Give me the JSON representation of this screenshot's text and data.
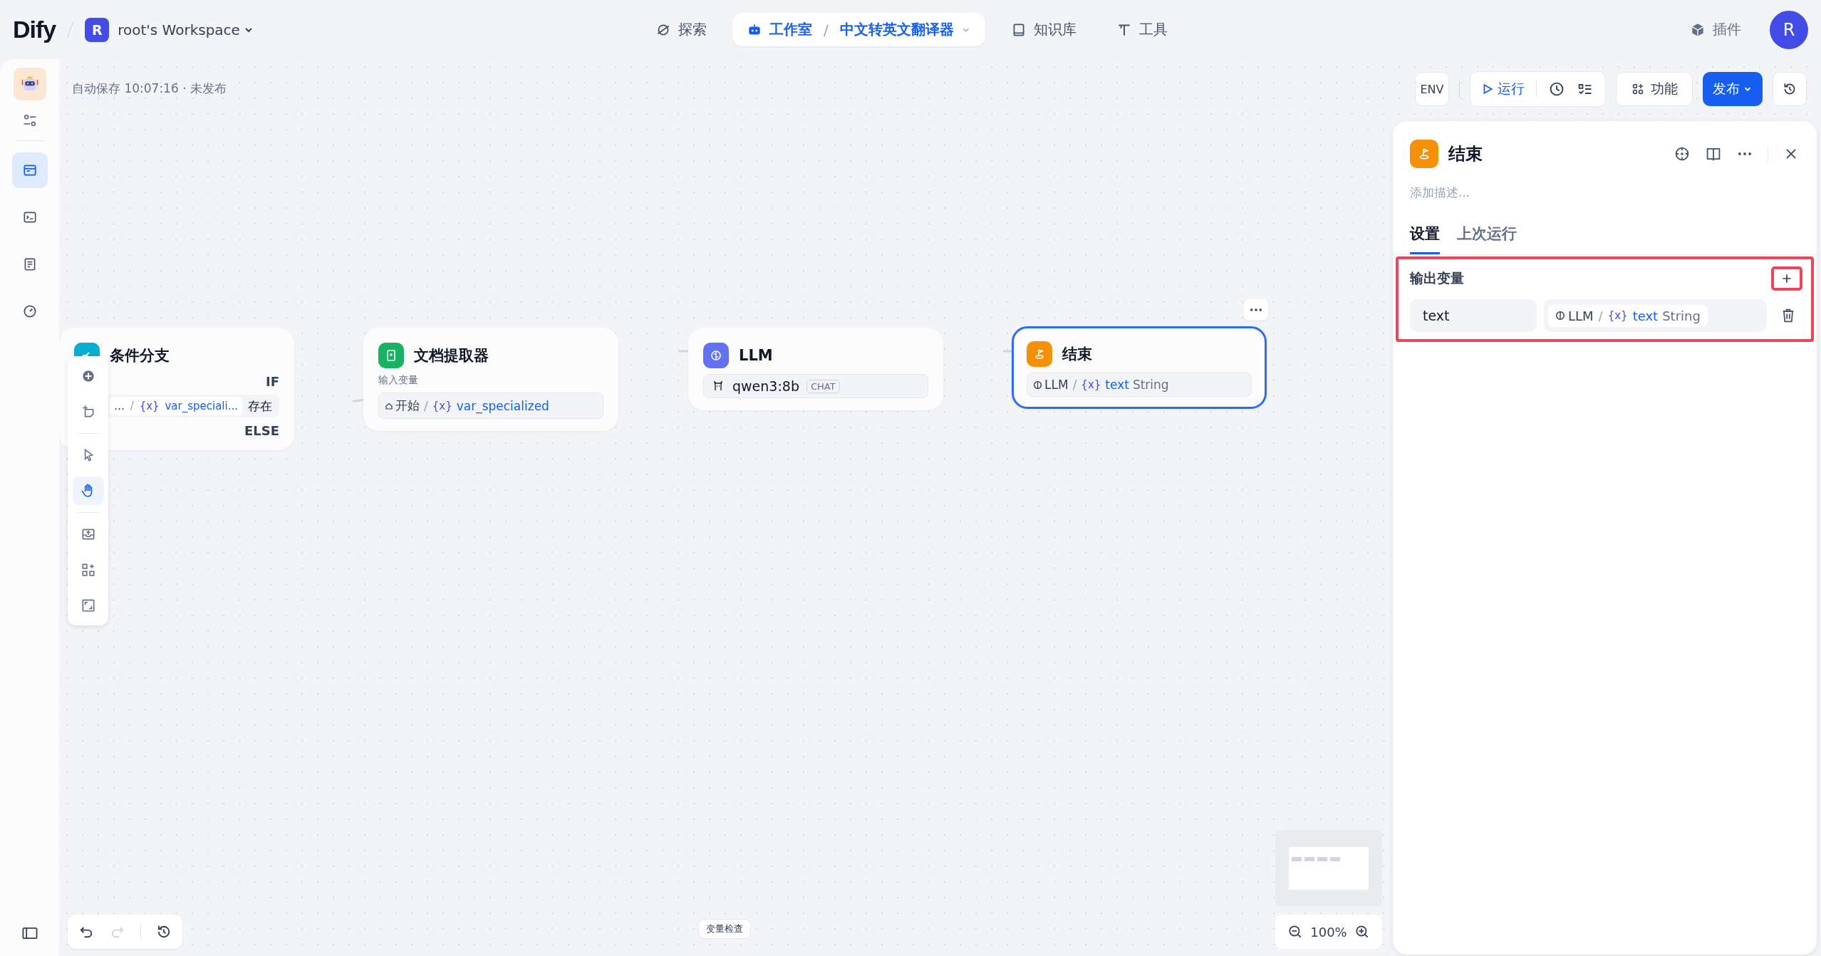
{
  "header": {
    "logo": "Dify",
    "workspace": {
      "initial": "R",
      "name": "root's Workspace"
    },
    "nav": [
      {
        "kind": "explore",
        "label": "探索",
        "selected": false
      },
      {
        "kind": "studio",
        "label": "工作室",
        "separator": "/",
        "app_name": "中文转英文翻译器",
        "selected": true
      },
      {
        "kind": "knowledge",
        "label": "知识库",
        "selected": false
      },
      {
        "kind": "tools",
        "label": "工具",
        "selected": false
      }
    ],
    "plugins": "插件",
    "avatar": "R"
  },
  "rail": [
    {
      "kind": "workflow",
      "selected": true
    },
    {
      "kind": "logs",
      "selected": false
    },
    {
      "kind": "annotations",
      "selected": false
    },
    {
      "kind": "monitor",
      "selected": false
    }
  ],
  "autosave": "自动保存 10:07:16 · 未发布",
  "toolbar": {
    "env": "ENV",
    "run": "运行",
    "features": "功能",
    "publish": "发布"
  },
  "nodes": [
    {
      "kind": "if-else",
      "title": "条件分支",
      "color": "#06aed4",
      "selected": false,
      "if_label": "IF",
      "else_label": "ELSE",
      "condition": {
        "ref": {
          "source": "…",
          "separator": "/",
          "marker": "{x}",
          "variable": "var_speciali..."
        },
        "operator": "存在"
      }
    },
    {
      "kind": "doc-extractor",
      "title": "文档提取器",
      "color": "#16b364",
      "selected": false,
      "input_label": "输入变量",
      "ref": {
        "source": "开始",
        "separator": "/",
        "marker": "{x}",
        "variable": "var_specialized"
      }
    },
    {
      "kind": "llm",
      "title": "LLM",
      "color": "#6172f3",
      "selected": false,
      "model": "qwen3:8b",
      "mode": "CHAT"
    },
    {
      "kind": "end",
      "title": "结束",
      "color": "#f79009",
      "selected": true,
      "ref": {
        "source": "LLM",
        "separator": "/",
        "marker": "{x}",
        "variable": "text",
        "type": "String"
      }
    }
  ],
  "canvas_tools": [
    {
      "kind": "add",
      "selected": false
    },
    {
      "kind": "note",
      "selected": false
    },
    {
      "kind": "pointer",
      "selected": false
    },
    {
      "kind": "hand",
      "selected": true
    },
    {
      "kind": "export",
      "selected": false
    },
    {
      "kind": "organize",
      "selected": false
    },
    {
      "kind": "maximize",
      "selected": false
    }
  ],
  "bottom": {
    "variable_check": "变量检查",
    "zoom": "100%"
  },
  "panel": {
    "title": "结束",
    "description_placeholder": "添加描述...",
    "tabs": [
      {
        "label": "设置",
        "selected": true
      },
      {
        "label": "上次运行",
        "selected": false
      }
    ],
    "section": "输出变量",
    "outputs": [
      {
        "name": "text",
        "ref": {
          "source": "LLM",
          "separator": "/",
          "marker": "{x}",
          "variable": "text",
          "type": "String"
        }
      }
    ]
  }
}
